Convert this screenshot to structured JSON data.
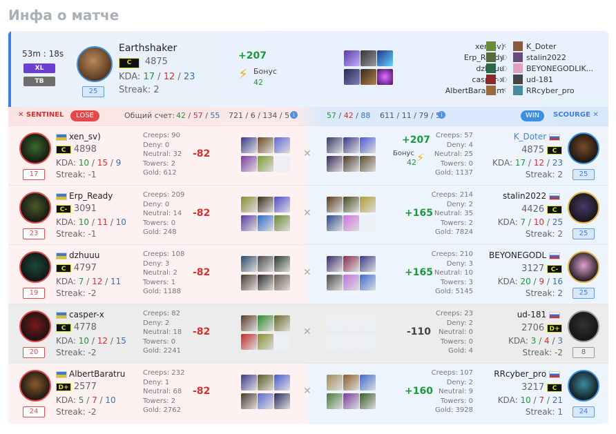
{
  "page_title": "Инфа о матче",
  "duration": "53m : 18s",
  "badges": [
    "XL",
    "TB"
  ],
  "header": {
    "hero": "Earthshaker",
    "rank": "C",
    "mmr": "4875",
    "level": "25",
    "kda_label": "KDA:",
    "k": "17",
    "d": "12",
    "a": "23",
    "streak": "Streak: 2",
    "gain": "+207",
    "bonus_label": "Бонус",
    "bonus": "42"
  },
  "header_sentinel": [
    "xen_sv)",
    "Erp_Ready",
    "dzhuuu",
    "casper-x",
    "AlbertBaratrum"
  ],
  "header_scourge": [
    "K_Doter",
    "stalin2022",
    "BEYONEGODLIK...",
    "ud-181",
    "RRcyber_pro"
  ],
  "scorebar": {
    "sentinel_label": "SENTINEL",
    "lose": "LOSE",
    "total_label": "Общий счет:",
    "left_k": "42",
    "left_d": "57",
    "left_a": "55",
    "left_extra": "721 / 6 / 134 / 5",
    "right_k": "57",
    "right_d": "42",
    "right_a": "88",
    "right_extra": "611 / 11 / 79 / 5",
    "win": "WIN",
    "scourge_label": "SCOURGE"
  },
  "colors": {
    "accent": "#3f7fe0",
    "win": "#3f8fe0",
    "lose": "#e24a4a",
    "kills": "#1a9a3a",
    "deaths": "#d83030",
    "assists": "#3a6fb8"
  },
  "rows": [
    {
      "l": {
        "name": "xen_sv)",
        "rank": "C",
        "mmr": "4898",
        "k": "10",
        "d": "15",
        "a": "9",
        "streak": "Streak: -1",
        "level": "17",
        "creeps": "Creeps: 90",
        "deny": "Deny: 0",
        "neutral": "Neutral: 32",
        "towers": "Towers: 2",
        "gold": "Gold: 612",
        "delta": "-82"
      },
      "r": {
        "name": "K_Doter",
        "rank": "C",
        "mmr": "4875",
        "k": "17",
        "d": "12",
        "a": "23",
        "streak": "Streak: 2",
        "level": "25",
        "creeps": "Creeps: 57",
        "deny": "Deny: 4",
        "neutral": "Neutral: 25",
        "towers": "Towers: 0",
        "gold": "Gold: 1137",
        "delta": "+207",
        "bonus_label": "Бонус",
        "bonus": "42"
      }
    },
    {
      "l": {
        "name": "Erp_Ready",
        "rank": "C-",
        "mmr": "3091",
        "k": "10",
        "d": "11",
        "a": "10",
        "streak": "Streak: -1",
        "level": "23",
        "creeps": "Creeps: 209",
        "deny": "Deny: 0",
        "neutral": "Neutral: 14",
        "towers": "Towers: 0",
        "gold": "Gold: 248",
        "delta": "-82"
      },
      "r": {
        "name": "stalin2022",
        "rank": "C",
        "mmr": "4426",
        "k": "7",
        "d": "10",
        "a": "25",
        "streak": "Streak: 2",
        "level": "25",
        "creeps": "Creeps: 214",
        "deny": "Deny: 2",
        "neutral": "Neutral: 35",
        "towers": "Towers: 2",
        "gold": "Gold: 7824",
        "delta": "+165"
      }
    },
    {
      "l": {
        "name": "dzhuuu",
        "rank": "C",
        "mmr": "4797",
        "k": "7",
        "d": "12",
        "a": "11",
        "streak": "Streak: -2",
        "level": "19",
        "creeps": "Creeps: 108",
        "deny": "Deny: 3",
        "neutral": "Neutral: 2",
        "towers": "Towers: 1",
        "gold": "Gold: 1188",
        "delta": "-82"
      },
      "r": {
        "name": "BEYONEGODL",
        "rank": "C-",
        "mmr": "3127",
        "k": "20",
        "d": "9",
        "a": "16",
        "streak": "Streak: 2",
        "level": "25",
        "creeps": "Creeps: 210",
        "deny": "Deny: 3",
        "neutral": "Neutral: 10",
        "towers": "Towers: 3",
        "gold": "Gold: 5145",
        "delta": "+165"
      }
    },
    {
      "l": {
        "name": "casper-x",
        "rank": "C",
        "mmr": "4778",
        "k": "10",
        "d": "12",
        "a": "15",
        "streak": "Streak: -2",
        "level": "20",
        "creeps": "Creeps: 82",
        "deny": "Deny: 2",
        "neutral": "Neutral: 18",
        "towers": "Towers: 0",
        "gold": "Gold: 2241",
        "delta": "-82"
      },
      "r": {
        "name": "ud-181",
        "rank": "D+",
        "mmr": "2706",
        "k": "3",
        "d": "4",
        "a": "3",
        "streak": "Streak: -2",
        "level": "8",
        "creeps": "Creeps: 23",
        "deny": "Deny: 2",
        "neutral": "Neutral: 0",
        "towers": "Towers: 0",
        "gold": "Gold: 4",
        "delta": "-110"
      }
    },
    {
      "l": {
        "name": "AlbertBaratru",
        "rank": "D+",
        "mmr": "2577",
        "k": "5",
        "d": "7",
        "a": "10",
        "streak": "Streak: -2",
        "level": "24",
        "creeps": "Creeps: 232",
        "deny": "Deny: 1",
        "neutral": "Neutral: 68",
        "towers": "Towers: 2",
        "gold": "Gold: 2762",
        "delta": "-82"
      },
      "r": {
        "name": "RRcyber_pro",
        "rank": "C",
        "mmr": "3217",
        "k": "10",
        "d": "7",
        "a": "21",
        "streak": "Streak: 1",
        "level": "24",
        "creeps": "Creeps: 107",
        "deny": "Deny: 2",
        "neutral": "Neutral: 9",
        "towers": "Towers: 0",
        "gold": "Gold: 3928",
        "delta": "+160"
      }
    }
  ]
}
